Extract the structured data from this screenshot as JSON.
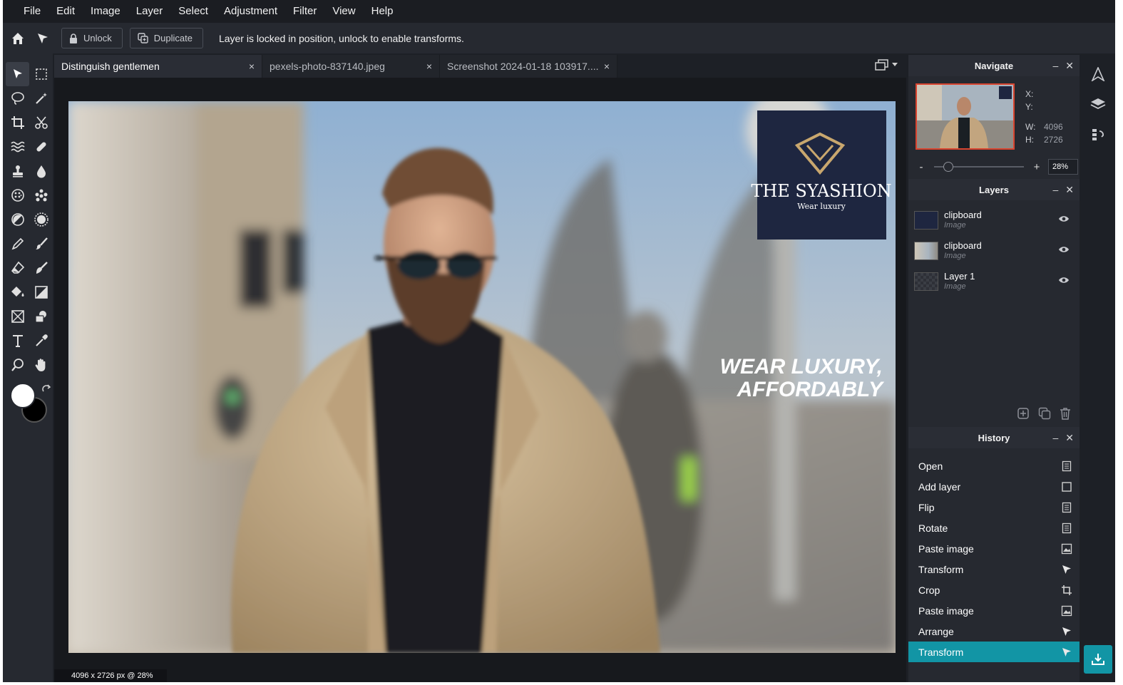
{
  "menu": [
    "File",
    "Edit",
    "Image",
    "Layer",
    "Select",
    "Adjustment",
    "Filter",
    "View",
    "Help"
  ],
  "options": {
    "unlock_label": "Unlock",
    "duplicate_label": "Duplicate",
    "message": "Layer is locked in position, unlock to enable transforms."
  },
  "tabs": [
    {
      "label": "Distinguish gentlemen",
      "close": "×"
    },
    {
      "label": "pexels-photo-837140.jpeg",
      "close": "×"
    },
    {
      "label": "Screenshot 2024-01-18 103917....",
      "close": "×"
    }
  ],
  "canvas": {
    "status": "4096 x 2726 px @ 28%",
    "logo_title": "THE SYASHION",
    "logo_subtitle": "Wear luxury",
    "tagline_1": "WEAR LUXURY,",
    "tagline_2": "AFFORDABLY"
  },
  "navigate": {
    "title": "Navigate",
    "x_label": "X:",
    "y_label": "Y:",
    "w_label": "W:",
    "w_value": "4096",
    "h_label": "H:",
    "h_value": "2726",
    "zoom_minus": "-",
    "zoom_plus": "+",
    "zoom_value": "28%",
    "zoom_level": 0.12
  },
  "layers": {
    "title": "Layers",
    "items": [
      {
        "name": "clipboard",
        "type": "Image"
      },
      {
        "name": "clipboard",
        "type": "Image"
      },
      {
        "name": "Layer 1",
        "type": "Image"
      }
    ]
  },
  "history": {
    "title": "History",
    "items": [
      {
        "label": "Open",
        "icon": "document-icon"
      },
      {
        "label": "Add layer",
        "icon": "square-icon"
      },
      {
        "label": "Flip",
        "icon": "document-icon"
      },
      {
        "label": "Rotate",
        "icon": "document-icon"
      },
      {
        "label": "Paste image",
        "icon": "image-icon"
      },
      {
        "label": "Transform",
        "icon": "pointer-icon"
      },
      {
        "label": "Crop",
        "icon": "crop-icon"
      },
      {
        "label": "Paste image",
        "icon": "image-icon"
      },
      {
        "label": "Arrange",
        "icon": "pointer-icon"
      },
      {
        "label": "Transform",
        "icon": "pointer-icon",
        "active": true
      }
    ]
  },
  "colors": {
    "accent": "#1295a5",
    "foreground": "#ffffff",
    "background": "#000000",
    "logo_bg": "#1e2640"
  }
}
